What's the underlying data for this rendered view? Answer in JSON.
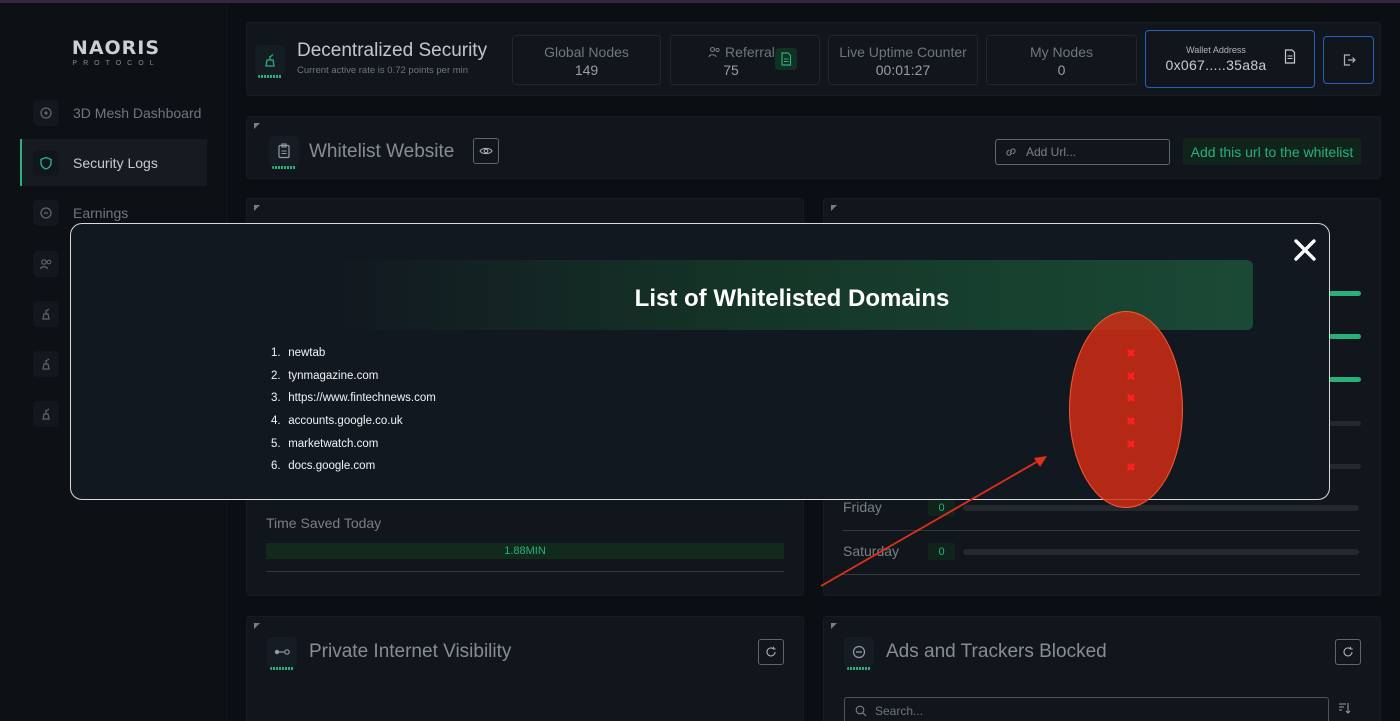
{
  "brand": {
    "name": "NAORIS",
    "sub": "PROTOCOL"
  },
  "sidebar": {
    "items": [
      {
        "label": "3D Mesh Dashboard"
      },
      {
        "label": "Security Logs"
      },
      {
        "label": "Earnings"
      }
    ]
  },
  "header": {
    "title": "Decentralized Security",
    "subtitle": "Current active rate is 0.72 points per min",
    "stats": [
      {
        "label": "Global Nodes",
        "value": "149"
      },
      {
        "label": "Referrals",
        "value": "75"
      },
      {
        "label": "Live Uptime Counter",
        "value": "00:01:27"
      },
      {
        "label": "My Nodes",
        "value": "0"
      }
    ],
    "wallet_label": "Wallet Address",
    "wallet_value": "0x067.....35a8a"
  },
  "whitelist": {
    "title": "Whitelist Website",
    "input_placeholder": "Add Url...",
    "add_button": "Add this url to the whitelist"
  },
  "time_saved": {
    "label": "Time Saved Today",
    "value": "1.88MIN"
  },
  "weekly": {
    "days": [
      {
        "day": "Friday",
        "count": "0"
      },
      {
        "day": "Saturday",
        "count": "0"
      }
    ]
  },
  "private_visibility": {
    "title": "Private Internet Visibility"
  },
  "ads_blocked": {
    "title": "Ads and Trackers Blocked",
    "search_placeholder": "Search..."
  },
  "modal": {
    "title": "List of Whitelisted Domains",
    "domains": [
      {
        "num": "1.",
        "name": "newtab"
      },
      {
        "num": "2.",
        "name": "tynmagazine.com"
      },
      {
        "num": "3.",
        "name": "https://www.fintechnews.com"
      },
      {
        "num": "4.",
        "name": "accounts.google.co.uk"
      },
      {
        "num": "5.",
        "name": "marketwatch.com"
      },
      {
        "num": "6.",
        "name": "docs.google.com"
      }
    ],
    "remove_glyph": "✖"
  },
  "colors": {
    "accent": "#2fc98a",
    "highlight": "#ff2020",
    "wallet_border": "#2d6fd6"
  }
}
